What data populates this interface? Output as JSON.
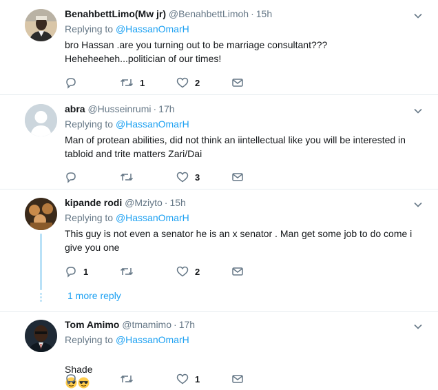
{
  "tweets": [
    {
      "name": "BenahbettLimo(Mw jr)",
      "handle": "@BenahbettLimoh",
      "time": "15h",
      "replying_label": "Replying to",
      "replying_to": "@HassanOmarH",
      "text": "bro Hassan .are you turning out to be marriage consultant???\nHeheheeheh...politician of our times!",
      "reply_count": "",
      "retweet_count": "1",
      "like_count": "2"
    },
    {
      "name": "abra",
      "handle": "@Husseinrumi",
      "time": "17h",
      "replying_label": "Replying to",
      "replying_to": "@HassanOmarH",
      "text": "Man of protean abilities, did not think an iintellectual like you will be interested in\ntabloid and trite matters Zari/Dai",
      "reply_count": "",
      "retweet_count": "",
      "like_count": "3"
    },
    {
      "name": "kipande rodi",
      "handle": "@Mziyto",
      "time": "15h",
      "replying_label": "Replying to",
      "replying_to": "@HassanOmarH",
      "text": "This guy is not even a senator he is an x senator . Man get some job to do come i\ngive you one",
      "reply_count": "1",
      "retweet_count": "",
      "like_count": "2",
      "more_replies": "1 more reply"
    },
    {
      "name": "Tom Amimo",
      "handle": "@tmamimo",
      "time": "17h",
      "replying_label": "Replying to",
      "replying_to": "@HassanOmarH",
      "text": "Shade",
      "reply_count": "",
      "retweet_count": "",
      "like_count": "1"
    }
  ],
  "separator": "·",
  "colors": {
    "link": "#1da1f2",
    "muted": "#657786",
    "divider": "#e6ecf0",
    "thread": "#b9e1f7"
  },
  "icons": [
    "reply-icon",
    "retweet-icon",
    "like-icon",
    "message-icon",
    "chevron-down-icon",
    "sunglasses-emoji-icon",
    "default-avatar-icon"
  ]
}
